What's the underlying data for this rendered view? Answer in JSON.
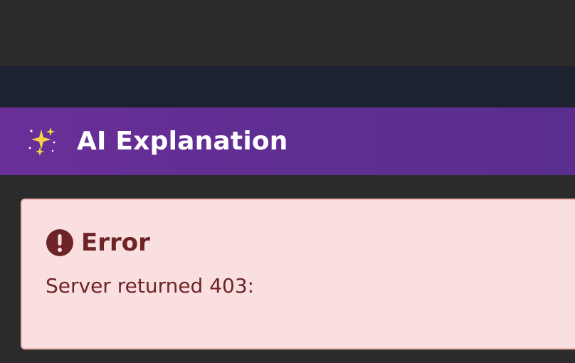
{
  "panel": {
    "icon": "sparkles-icon",
    "title": "AI Explanation"
  },
  "error": {
    "icon": "exclamation-circle-icon",
    "title": "Error",
    "message": "Server returned 403:"
  },
  "colors": {
    "header_background": "#5f2e91",
    "error_background": "#f9dfdf",
    "error_text": "#6e2426",
    "error_border": "#f2b8b8",
    "page_background": "#2b2b2b",
    "nav_background": "#1c2230"
  }
}
